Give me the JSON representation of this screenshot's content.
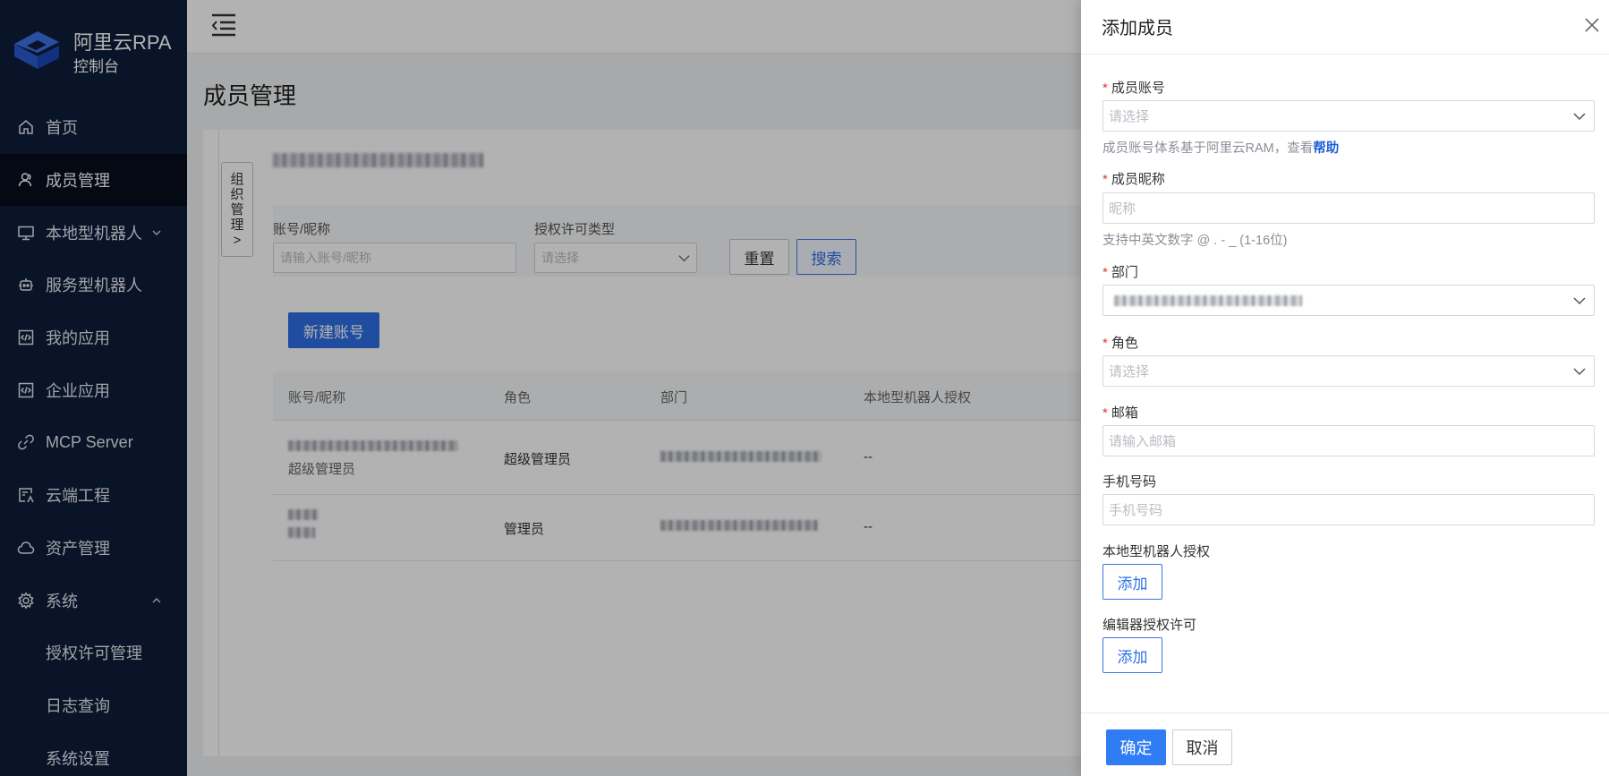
{
  "brand": {
    "title": "阿里云RPA",
    "subtitle": "控制台"
  },
  "sidebar": {
    "items": [
      {
        "label": "首页",
        "icon": "home-icon"
      },
      {
        "label": "成员管理",
        "icon": "user-icon"
      },
      {
        "label": "本地型机器人",
        "icon": "monitor-icon"
      },
      {
        "label": "服务型机器人",
        "icon": "robot-icon"
      },
      {
        "label": "我的应用",
        "icon": "code-icon"
      },
      {
        "label": "企业应用",
        "icon": "code-icon"
      },
      {
        "label": "MCP Server",
        "icon": "link-icon"
      },
      {
        "label": "云端工程",
        "icon": "cloud-project-icon"
      },
      {
        "label": "资产管理",
        "icon": "cloud-icon"
      },
      {
        "label": "系统",
        "icon": "gear-icon"
      },
      {
        "label": "授权许可管理"
      },
      {
        "label": "日志查询"
      },
      {
        "label": "系统设置"
      }
    ]
  },
  "main": {
    "page_title": "成员管理",
    "org_tab": [
      "组",
      "织",
      "管",
      "理",
      ">"
    ],
    "filters": {
      "account_label": "账号/昵称",
      "account_placeholder": "请输入账号/昵称",
      "license_label": "授权许可类型",
      "license_placeholder": "请选择",
      "reset": "重置",
      "search": "搜索"
    },
    "new_account": "新建账号",
    "table": {
      "headers": [
        "账号/昵称",
        "角色",
        "部门",
        "本地型机器人授权"
      ],
      "rows": [
        {
          "nickname": "超级管理员",
          "role": "超级管理员",
          "robot_auth": "--"
        },
        {
          "nickname": "",
          "role": "管理员",
          "robot_auth": "--"
        }
      ]
    }
  },
  "drawer": {
    "title": "添加成员",
    "fields": {
      "account": {
        "label": "成员账号",
        "placeholder": "请选择",
        "hint": "成员账号体系基于阿里云RAM，查看",
        "hint_link": "帮助"
      },
      "nickname": {
        "label": "成员昵称",
        "placeholder": "昵称",
        "hint": "支持中英文数字 @ . - _ (1-16位)"
      },
      "department": {
        "label": "部门"
      },
      "role": {
        "label": "角色",
        "placeholder": "请选择"
      },
      "email": {
        "label": "邮箱",
        "placeholder": "请输入邮箱"
      },
      "phone": {
        "label": "手机号码",
        "placeholder": "手机号码"
      },
      "robot_auth": {
        "label": "本地型机器人授权",
        "button": "添加"
      },
      "editor_license": {
        "label": "编辑器授权许可",
        "button": "添加"
      }
    },
    "required_mark": "*",
    "ok": "确定",
    "cancel": "取消"
  }
}
